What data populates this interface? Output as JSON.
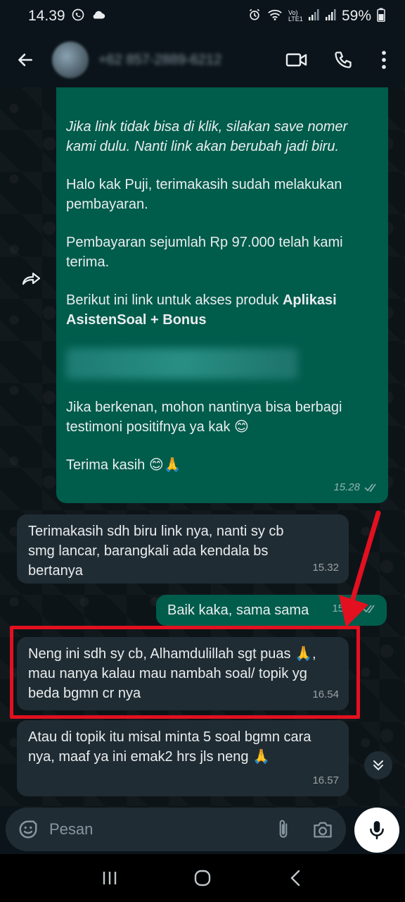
{
  "status_bar": {
    "time": "14.39",
    "battery": "59%",
    "volte": "Vo) LTE1"
  },
  "header": {
    "contact": "+62 857-2889-6212"
  },
  "messages": [
    {
      "direction": "out",
      "paragraphs": [
        "Jika link tidak bisa di klik, silakan save nomer kami dulu. Nanti link akan berubah jadi biru.",
        "Halo kak Puji, terimakasih sudah melakukan pembayaran.",
        "Pembayaran sejumlah Rp 97.000 telah kami terima.",
        "Berikut ini link untuk akses produk",
        "Aplikasi AsistenSoal + Bonus",
        "Jika berkenan, mohon nantinya bisa berbagi testimoni positifnya ya kak 😊",
        "Terima kasih 😊🙏"
      ],
      "time": "15.28"
    },
    {
      "direction": "in",
      "text": "Terimakasih sdh biru link nya, nanti sy cb smg lancar, barangkali ada kendala bs bertanya",
      "time": "15.32"
    },
    {
      "direction": "out",
      "text": "Baik kaka, sama sama",
      "time": "15.42"
    },
    {
      "direction": "in",
      "text": "Neng ini sdh sy cb, Alhamdulillah sgt puas 🙏, mau nanya kalau mau nambah soal/ topik yg beda bgmn cr nya",
      "time": "16.54"
    },
    {
      "direction": "in",
      "text": "Atau di topik itu misal minta 5 soal bgmn cara nya, maaf ya ini emak2 hrs jls neng 🙏",
      "time": "16.57"
    }
  ],
  "composer": {
    "placeholder": "Pesan"
  },
  "colors": {
    "outgoing_bubble": "#005c4b",
    "incoming_bubble": "#202c33",
    "highlight": "#e3101f",
    "background": "#0b141a"
  }
}
